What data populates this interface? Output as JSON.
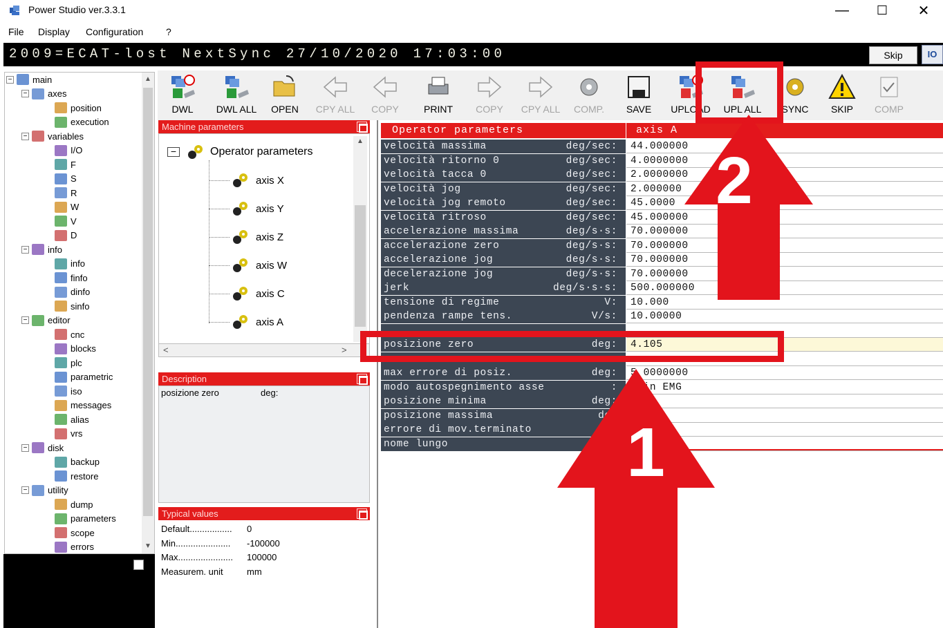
{
  "window": {
    "title": "Power Studio ver.3.3.1",
    "minimize": "—",
    "maximize": "☐",
    "close": "✕"
  },
  "menu": [
    "File",
    "Display",
    "Configuration",
    "?"
  ],
  "status": {
    "message": "2009=ECAT-lost NextSync 27/10/2020 17:03:00",
    "skip_label": "Skip",
    "icon_text": "IO"
  },
  "tree": {
    "items": [
      {
        "label": "main",
        "icon": "computer-icon"
      },
      {
        "label": "axes",
        "icon": "axes-icon"
      },
      {
        "label": "position",
        "icon": "position-icon"
      },
      {
        "label": "execution",
        "icon": "execution-icon"
      },
      {
        "label": "variables",
        "icon": "variables-icon"
      },
      {
        "label": "I/O",
        "icon": "io-icon"
      },
      {
        "label": "F",
        "icon": "f-icon"
      },
      {
        "label": "S",
        "icon": "s-icon"
      },
      {
        "label": "R",
        "icon": "r-icon"
      },
      {
        "label": "W",
        "icon": "w-icon"
      },
      {
        "label": "V",
        "icon": "v-icon"
      },
      {
        "label": "D",
        "icon": "d-icon"
      },
      {
        "label": "info",
        "icon": "info-folder-icon"
      },
      {
        "label": "info",
        "icon": "info-icon"
      },
      {
        "label": "finfo",
        "icon": "finfo-icon"
      },
      {
        "label": "dinfo",
        "icon": "dinfo-icon"
      },
      {
        "label": "sinfo",
        "icon": "sinfo-icon"
      },
      {
        "label": "editor",
        "icon": "editor-icon"
      },
      {
        "label": "cnc",
        "icon": "cnc-icon"
      },
      {
        "label": "blocks",
        "icon": "blocks-icon"
      },
      {
        "label": "plc",
        "icon": "plc-icon"
      },
      {
        "label": "parametric",
        "icon": "parametric-icon"
      },
      {
        "label": "iso",
        "icon": "iso-icon"
      },
      {
        "label": "messages",
        "icon": "messages-icon"
      },
      {
        "label": "alias",
        "icon": "alias-icon"
      },
      {
        "label": "vrs",
        "icon": "vrs-icon"
      },
      {
        "label": "disk",
        "icon": "disk-icon"
      },
      {
        "label": "backup",
        "icon": "backup-icon"
      },
      {
        "label": "restore",
        "icon": "restore-icon"
      },
      {
        "label": "utility",
        "icon": "utility-icon"
      },
      {
        "label": "dump",
        "icon": "dump-icon"
      },
      {
        "label": "parameters",
        "icon": "parameters-icon"
      },
      {
        "label": "scope",
        "icon": "scope-icon"
      },
      {
        "label": "errors",
        "icon": "errors-icon"
      }
    ]
  },
  "toolbar": {
    "buttons": [
      {
        "label": "DWL",
        "icon": "download-one-icon",
        "enabled": true
      },
      {
        "label": "DWL ALL",
        "icon": "download-all-icon",
        "enabled": true
      },
      {
        "label": "OPEN",
        "icon": "open-folder-icon",
        "enabled": true
      },
      {
        "label": "CPY ALL",
        "icon": "copy-all-left-icon",
        "enabled": false
      },
      {
        "label": "COPY",
        "icon": "copy-left-icon",
        "enabled": false
      },
      {
        "label": "PRINT",
        "icon": "printer-icon",
        "enabled": true
      },
      {
        "label": "COPY",
        "icon": "copy-right-icon",
        "enabled": false
      },
      {
        "label": "CPY ALL",
        "icon": "copy-all-right-icon",
        "enabled": false
      },
      {
        "label": "COMP.",
        "icon": "compare-icon",
        "enabled": false
      },
      {
        "label": "SAVE",
        "icon": "save-icon",
        "enabled": true
      },
      {
        "label": "UPLOAD",
        "icon": "upload-one-icon",
        "enabled": true
      },
      {
        "label": "UPL ALL",
        "icon": "upload-all-icon",
        "enabled": true
      },
      {
        "label": "SYNC",
        "icon": "sync-icon",
        "enabled": true
      },
      {
        "label": "SKIP",
        "icon": "warning-icon",
        "enabled": true
      },
      {
        "label": "COMP",
        "icon": "compare-doc-icon",
        "enabled": false
      }
    ]
  },
  "machine_params": {
    "title": "Machine parameters",
    "root": "Operator parameters",
    "axes": [
      "axis X",
      "axis Y",
      "axis Z",
      "axis W",
      "axis C",
      "axis A"
    ]
  },
  "description": {
    "title": "Description",
    "name": "posizione zero",
    "unit": "deg:"
  },
  "typical": {
    "title": "Typical values",
    "rows": [
      {
        "key": "Default.................",
        "value": "0"
      },
      {
        "key": "Min......................",
        "value": "-100000"
      },
      {
        "key": "Max......................",
        "value": "100000"
      },
      {
        "key": "Measurem. unit",
        "value": "mm"
      }
    ]
  },
  "grid": {
    "header_left": "Operator parameters",
    "header_right": "axis A",
    "rows": [
      {
        "name": "velocità massima",
        "unit": "deg/sec:",
        "value": "44.000000"
      },
      {
        "name": "velocità ritorno 0",
        "unit": "deg/sec:",
        "value": "4.0000000"
      },
      {
        "name": "velocità tacca 0",
        "unit": "deg/sec:",
        "value": "2.0000000"
      },
      {
        "name": "velocità jog",
        "unit": "deg/sec:",
        "value": "2.000000"
      },
      {
        "name": "velocità jog remoto",
        "unit": "deg/sec:",
        "value": "45.0000"
      },
      {
        "name": "velocità ritroso",
        "unit": "deg/sec:",
        "value": "45.000000"
      },
      {
        "name": "accelerazione massima",
        "unit": "deg/s·s:",
        "value": "70.000000"
      },
      {
        "name": "accelerazione zero",
        "unit": "deg/s·s:",
        "value": "70.000000"
      },
      {
        "name": "accelerazione jog",
        "unit": "deg/s·s:",
        "value": "70.000000"
      },
      {
        "name": "decelerazione jog",
        "unit": "deg/s·s:",
        "value": "70.000000"
      },
      {
        "name": "jerk",
        "unit": "deg/s·s·s:",
        "value": "500.000000"
      },
      {
        "name": "tensione di regime",
        "unit": "V:",
        "value": "10.000"
      },
      {
        "name": "pendenza rampe tens.",
        "unit": "V/s:",
        "value": "10.00000"
      },
      {
        "name": "",
        "unit": "",
        "value": ""
      },
      {
        "name": "posizione zero",
        "unit": "deg:",
        "value": "4.105"
      },
      {
        "name": "",
        "unit": "",
        "value": ""
      },
      {
        "name": "max errore di posiz.",
        "unit": "deg:",
        "value": "5 0000000"
      },
      {
        "name": "modo autospegnimento asse",
        "unit": ":",
        "value": "y in EMG"
      },
      {
        "name": "posizione minima",
        "unit": "deg:",
        "value": ""
      },
      {
        "name": "posizione massima",
        "unit": "deg",
        "value": ""
      },
      {
        "name": "errore di mov.terminato",
        "unit": "de",
        "value": "00"
      },
      {
        "name": "nome lungo",
        "unit": "",
        "value": ""
      }
    ]
  },
  "annotations": {
    "step1": "1",
    "step2": "2",
    "highlight_color": "#e3141c"
  },
  "colors": {
    "accent_red": "#e31c1c",
    "grid_name_bg": "#3c4653",
    "status_bg": "#000000"
  }
}
